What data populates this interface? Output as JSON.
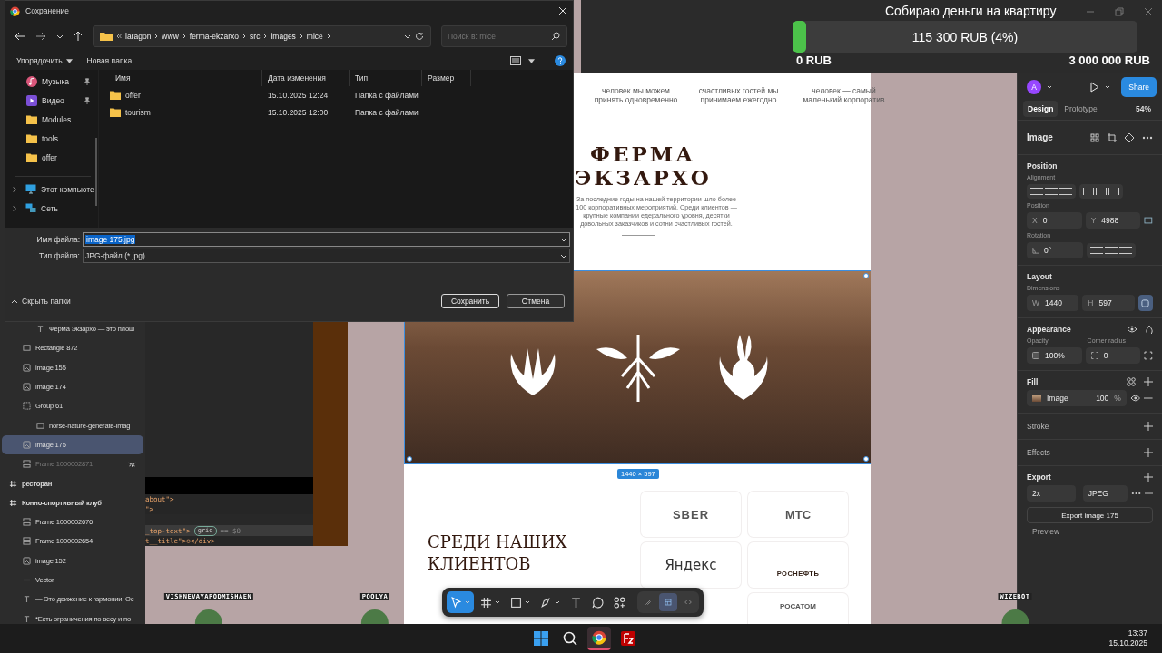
{
  "dialog": {
    "title": "Сохранение",
    "path": [
      "laragon",
      "www",
      "ferma-ekzarxo",
      "src",
      "images",
      "mice"
    ],
    "search": {
      "placeholder": "Поиск в: mice"
    },
    "toolbar": [
      "Упорядочить",
      "Новая папка"
    ],
    "quick_access": [
      {
        "label": "Музыка",
        "kind": "music",
        "pinned": true
      },
      {
        "label": "Видео",
        "kind": "video",
        "pinned": true
      },
      {
        "label": "Modules",
        "kind": "folder",
        "pinned": false
      },
      {
        "label": "tools",
        "kind": "folder",
        "pinned": false
      },
      {
        "label": "offer",
        "kind": "folder",
        "pinned": false
      }
    ],
    "locations": [
      {
        "label": "Этот компьюте",
        "kind": "computer"
      },
      {
        "label": "Сеть",
        "kind": "network"
      }
    ],
    "columns": [
      "Имя",
      "Дата изменения",
      "Тип",
      "Размер"
    ],
    "files": [
      {
        "name": "offer",
        "modified": "15.10.2025 12:24",
        "type": "Папка с файлами"
      },
      {
        "name": "tourism",
        "modified": "15.10.2025 12:00",
        "type": "Папка с файлами"
      }
    ],
    "file_name": {
      "label": "Имя файла:",
      "value": "image 175.jpg",
      "value_selected": true
    },
    "file_type": {
      "label": "Тип файла:",
      "value": "JPG-файл (*.jpg)"
    },
    "hide_folders": "Скрыть папки",
    "buttons": [
      "Сохранить",
      "Отмена"
    ]
  },
  "donation": {
    "title": "Собираю деньги на квартиру",
    "level": 0.04,
    "reading": "115 300 RUB (4%)",
    "min": "0 RUB",
    "max": "3 000 000 RUB"
  },
  "layers": [
    {
      "kind": "none",
      "children": [
        {
          "kind": "none",
          "children": [
            {
              "name": "Ферма Экзархо — это плош",
              "kind": "text",
              "selected": false,
              "visible": true
            }
          ]
        },
        {
          "name": "Rectangle 872",
          "kind": "rectangle",
          "selected": false,
          "visible": true
        },
        {
          "name": "image 155",
          "kind": "image",
          "selected": false,
          "visible": true
        },
        {
          "name": "image 174",
          "kind": "image",
          "selected": false,
          "visible": true
        },
        {
          "name": "Group 61",
          "kind": "group",
          "selected": false,
          "visible": true,
          "children": [
            {
              "name": "horse-nature-generate-imag",
              "kind": "rectangle",
              "selected": false,
              "visible": true
            }
          ]
        },
        {
          "name": "image 175",
          "kind": "image",
          "selected": true,
          "visible": true
        },
        {
          "name": "Frame 1000002871",
          "kind": "autolayout",
          "selected": false,
          "visible": false
        }
      ]
    },
    {
      "name": "ресторан",
      "kind": "frame",
      "selected": false,
      "visible": true
    },
    {
      "name": "Конно-спортивный клуб",
      "kind": "frame",
      "selected": false,
      "visible": true,
      "children": [
        {
          "name": "Frame 1000002676",
          "kind": "autolayout",
          "selected": false,
          "visible": true
        },
        {
          "name": "Frame 1000002654",
          "kind": "autolayout",
          "selected": false,
          "visible": true
        },
        {
          "name": "image 152",
          "kind": "image",
          "selected": false,
          "visible": true
        },
        {
          "name": "Vector",
          "kind": "vector",
          "selected": false,
          "visible": true
        },
        {
          "name": "— Это движение к гармонии. Ос",
          "kind": "text",
          "selected": false,
          "visible": true
        },
        {
          "name": "*Есть ограничения по весу и по",
          "kind": "text",
          "selected": false,
          "visible": true
        }
      ]
    }
  ],
  "devtools": [
    {
      "text": "about\">",
      "selected": false
    },
    {
      "text": "\">",
      "selected": false
    },
    {
      "text": "_top-text\">",
      "badge": "grid",
      "suffix": "== $0",
      "selected": true
    },
    {
      "text": "t__title\">⊖</div>",
      "selected": false
    }
  ],
  "page": {
    "stats": [
      "человек мы можем принять одновременно",
      "счастливых гостей мы принимаем ежегодно",
      "человек — самый маленький корпоратив"
    ],
    "title": [
      "ФЕРМА",
      "ЭКЗАРХО"
    ],
    "paragraph": "За последние годы на нашей территории шло более 100 корпоративных мероприятий. Среди клиентов — крупные компании едерального уровня, десятки довольных заказчиков и сотни счастливых гостей.",
    "size_badge": "1440 × 597",
    "clients_title": "СРЕДИ НАШИХ КЛИЕНТОВ",
    "logos": [
      {
        "name": "SBER",
        "kind": "sber"
      },
      {
        "name": "МТС",
        "kind": "mts"
      },
      {
        "name": "Яндекс",
        "kind": "yandex"
      },
      {
        "name": "РОСНЕФТЬ",
        "kind": "rosneft"
      },
      {
        "name": "РОСАТОМ",
        "kind": "rosatom"
      }
    ]
  },
  "inspector": {
    "user_initial": "A",
    "share": "Share",
    "tabs": [
      {
        "label": "Design",
        "selected": true
      },
      {
        "label": "Prototype",
        "selected": false
      }
    ],
    "zoom": "54%",
    "layer_title": "Image",
    "position": {
      "title": "Position",
      "alignment_label": "Alignment",
      "position_label": "Position",
      "x": {
        "label": "X",
        "value": "0"
      },
      "y": {
        "label": "Y",
        "value": "4988"
      },
      "rotation_label": "Rotation",
      "rotation": "0°"
    },
    "layout": {
      "title": "Layout",
      "dimensions_label": "Dimensions",
      "w": {
        "label": "W",
        "value": "1440"
      },
      "h": {
        "label": "H",
        "value": "597"
      },
      "constrain": true
    },
    "appearance": {
      "title": "Appearance",
      "opacity_label": "Opacity",
      "opacity": "100%",
      "radius_label": "Corner radius",
      "radius": "0"
    },
    "fill": {
      "title": "Fill",
      "type": "Image",
      "opacity": "100",
      "unit": "%"
    },
    "stroke": "Stroke",
    "effects": "Effects",
    "export": {
      "title": "Export",
      "scale": "2x",
      "format": "JPEG",
      "button": "Export image 175",
      "preview": "Preview"
    }
  },
  "tools": [
    {
      "kind": "move",
      "selected": true,
      "menu": true
    },
    {
      "kind": "frame",
      "selected": false,
      "menu": true
    },
    {
      "kind": "shape",
      "selected": false,
      "menu": true
    },
    {
      "kind": "pen",
      "selected": false,
      "menu": true
    },
    {
      "kind": "text",
      "selected": false,
      "menu": false
    },
    {
      "kind": "comment",
      "selected": false,
      "menu": false
    },
    {
      "kind": "actions",
      "selected": false,
      "menu": false
    }
  ],
  "modes": [
    {
      "kind": "draw",
      "selected": false
    },
    {
      "kind": "design",
      "selected": true
    },
    {
      "kind": "dev",
      "selected": false
    }
  ],
  "viewers": [
    {
      "name": "VISHNEVAYAPODMISHAEN"
    },
    {
      "name": "POOLYA"
    },
    {
      "name": "WIZEBOT"
    }
  ],
  "taskbar": {
    "apps": [
      {
        "kind": "start",
        "active": false
      },
      {
        "kind": "search",
        "active": false
      },
      {
        "kind": "chrome",
        "active": true
      },
      {
        "kind": "filezilla",
        "active": false
      }
    ],
    "time": "13:37",
    "date": "15.10.2025"
  }
}
